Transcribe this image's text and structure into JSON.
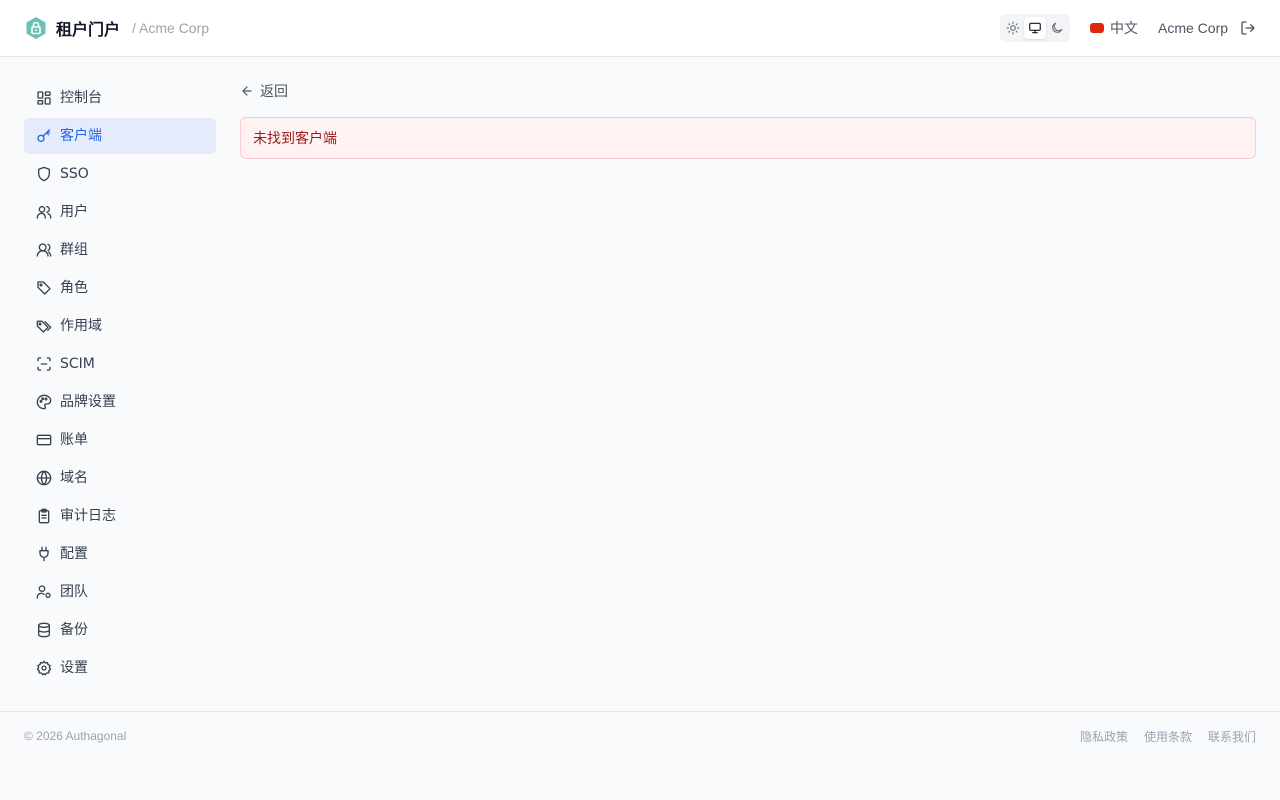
{
  "colors": {
    "accent": "#2563eb",
    "active_bg": "#e4ebfa",
    "logo": "#6bbfb4",
    "error_text": "#991b1b",
    "error_bg": "#fef2f2",
    "error_border": "#fecaca"
  },
  "header": {
    "title": "租户门户",
    "org_breadcrumb": "/ Acme Corp",
    "theme": {
      "options": [
        {
          "name": "light",
          "icon": "sun-icon",
          "active": false
        },
        {
          "name": "system",
          "icon": "monitor-icon",
          "active": true
        },
        {
          "name": "dark",
          "icon": "moon-icon",
          "active": false
        }
      ]
    },
    "language": {
      "flag": "cn-flag-icon",
      "label": "中文"
    },
    "org_name": "Acme Corp",
    "logout_icon": "logout-icon"
  },
  "sidebar": {
    "items": [
      {
        "label": "控制台",
        "icon": "dashboard-icon",
        "active": false
      },
      {
        "label": "客户端",
        "icon": "key-icon",
        "active": true
      },
      {
        "label": "SSO",
        "icon": "shield-icon",
        "active": false
      },
      {
        "label": "用户",
        "icon": "users-icon",
        "active": false
      },
      {
        "label": "群组",
        "icon": "group-icon",
        "active": false
      },
      {
        "label": "角色",
        "icon": "tag-icon",
        "active": false
      },
      {
        "label": "作用域",
        "icon": "tags-icon",
        "active": false
      },
      {
        "label": "SCIM",
        "icon": "scan-icon",
        "active": false
      },
      {
        "label": "品牌设置",
        "icon": "palette-icon",
        "active": false
      },
      {
        "label": "账单",
        "icon": "credit-card-icon",
        "active": false
      },
      {
        "label": "域名",
        "icon": "globe-icon",
        "active": false
      },
      {
        "label": "审计日志",
        "icon": "clipboard-icon",
        "active": false
      },
      {
        "label": "配置",
        "icon": "plug-icon",
        "active": false
      },
      {
        "label": "团队",
        "icon": "user-cog-icon",
        "active": false
      },
      {
        "label": "备份",
        "icon": "database-icon",
        "active": false
      },
      {
        "label": "设置",
        "icon": "gear-icon",
        "active": false
      }
    ]
  },
  "main": {
    "back_label": "返回",
    "alert_text": "未找到客户端"
  },
  "footer": {
    "copyright": "© 2026 Authagonal",
    "links": [
      "隐私政策",
      "使用条款",
      "联系我们"
    ]
  }
}
